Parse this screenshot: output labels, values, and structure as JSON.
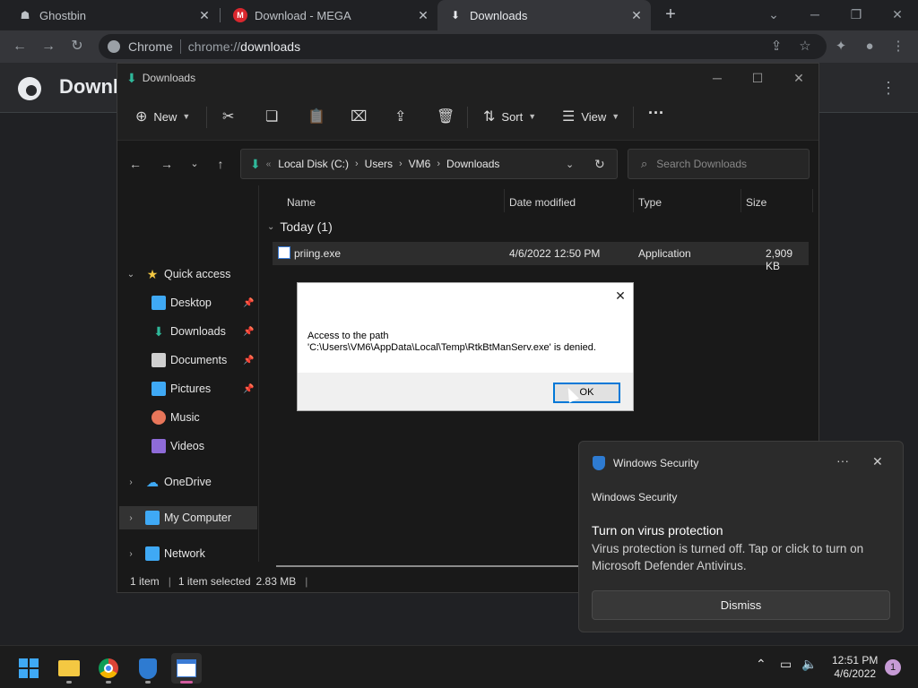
{
  "browser": {
    "tabs": [
      {
        "label": "Ghostbin",
        "icon": "ghost-icon"
      },
      {
        "label": "Download - MEGA",
        "icon": "mega-icon"
      },
      {
        "label": "Downloads",
        "icon": "download-icon",
        "active": true
      }
    ],
    "omnibox": {
      "site": "Chrome",
      "scheme": "chrome://",
      "host": "downloads"
    },
    "page_title": "Downl"
  },
  "explorer": {
    "title": "Downloads",
    "commands": {
      "new": "New",
      "sort": "Sort",
      "view": "View"
    },
    "breadcrumb": [
      "Local Disk (C:)",
      "Users",
      "VM6",
      "Downloads"
    ],
    "search_placeholder": "Search Downloads",
    "sidebar": {
      "quick_access": "Quick access",
      "items": [
        "Desktop",
        "Downloads",
        "Documents",
        "Pictures",
        "Music",
        "Videos"
      ],
      "onedrive": "OneDrive",
      "my_computer": "My Computer",
      "network": "Network"
    },
    "columns": {
      "name": "Name",
      "date": "Date modified",
      "type": "Type",
      "size": "Size"
    },
    "group": "Today (1)",
    "file": {
      "name": "priing.exe",
      "date": "4/6/2022 12:50 PM",
      "type": "Application",
      "size": "2,909 KB"
    },
    "status": {
      "count": "1 item",
      "selected": "1 item selected",
      "size": "2.83 MB"
    }
  },
  "dialog": {
    "message_line1": "Access to the path",
    "message_line2": "'C:\\Users\\VM6\\AppData\\Local\\Temp\\RtkBtManServ.exe' is denied.",
    "ok": "OK"
  },
  "toast": {
    "app": "Windows Security",
    "subtitle": "Windows Security",
    "heading": "Turn on virus protection",
    "body": "Virus protection is turned off. Tap or click to turn on Microsoft Defender Antivirus.",
    "button": "Dismiss"
  },
  "taskbar": {
    "time": "12:51 PM",
    "date": "4/6/2022",
    "notifications": "1"
  },
  "colors": {
    "accent": "#0078d7",
    "download_green": "#2fb89a",
    "notif_badge": "#c79bd6"
  }
}
